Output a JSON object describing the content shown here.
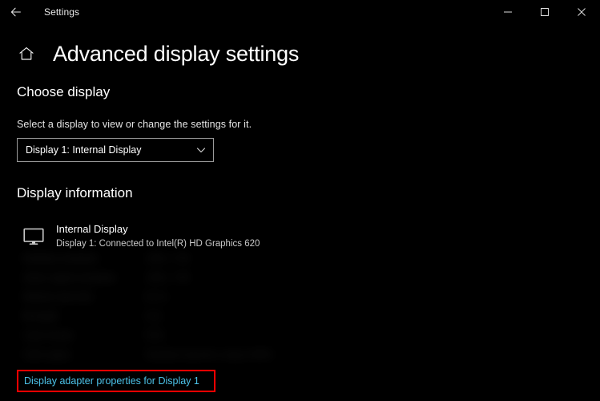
{
  "titlebar": {
    "back_icon": "arrow-left-icon",
    "app_title": "Settings",
    "minimize_label": "─",
    "maximize_label": "☐",
    "close_label": "✕"
  },
  "header": {
    "home_icon": "home-icon",
    "page_title": "Advanced display settings"
  },
  "choose_display": {
    "heading": "Choose display",
    "description": "Select a display to view or change the settings for it.",
    "selected_value": "Display 1: Internal Display",
    "chevron_icon": "chevron-down-icon"
  },
  "display_information": {
    "heading": "Display information",
    "monitor_icon": "monitor-icon",
    "display_name": "Internal Display",
    "display_sub": "Display 1: Connected to Intel(R) HD Graphics 620",
    "specs": [
      {
        "label": "Desktop resolution",
        "value": "1366 x 768"
      },
      {
        "label": "Active signal resolution",
        "value": "1366 x 768"
      },
      {
        "label": "Refresh rate (Hz)",
        "value": "60 Hz"
      },
      {
        "label": "Bit depth",
        "value": "8-bit"
      },
      {
        "label": "Color format",
        "value": "RGB"
      },
      {
        "label": "Color space",
        "value": "Standard dynamic range (SDR)"
      }
    ]
  },
  "adapter_link": {
    "label": "Display adapter properties for Display 1",
    "highlight_color": "#ff0000",
    "link_color": "#4cc2e8"
  }
}
